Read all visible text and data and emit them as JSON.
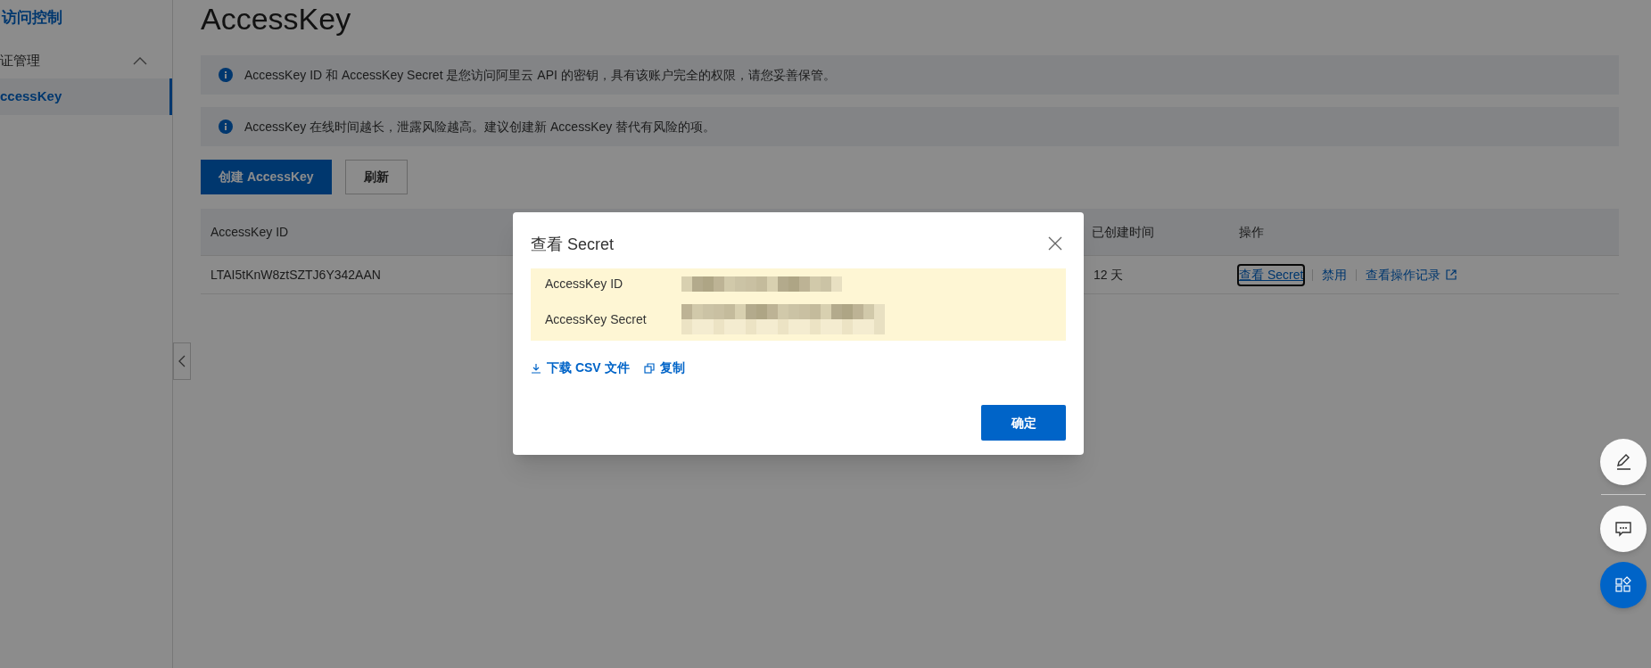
{
  "sidebar": {
    "title": "访问控制",
    "groups": [
      {
        "label": "证管理",
        "expanded": true,
        "items": [
          {
            "label": "ccessKey",
            "selected": true
          }
        ]
      }
    ]
  },
  "page_title": "AccessKey",
  "notices": [
    "AccessKey ID 和 AccessKey Secret 是您访问阿里云 API 的密钥，具有该账户完全的权限，请您妥善保管。",
    "AccessKey 在线时间越长，泄露风险越高。建议创建新 AccessKey 替代有风险的项。"
  ],
  "toolbar": [
    {
      "label": "创建 AccessKey",
      "kind": "primary"
    },
    {
      "label": "刷新",
      "kind": "secondary"
    }
  ],
  "table": {
    "columns": [
      "AccessKey ID",
      "已创建时间",
      "操作"
    ],
    "rows": [
      {
        "id": "LTAI5tKnW8ztSZTJ6Y342AAN",
        "age": "12 天",
        "actions": [
          {
            "label": "查看 Secret",
            "focused": true,
            "external": false
          },
          {
            "label": "禁用",
            "focused": false,
            "external": false
          },
          {
            "label": "查看操作记录",
            "focused": false,
            "external": true
          }
        ]
      }
    ]
  },
  "dialog": {
    "title": "查看 Secret",
    "fields": [
      {
        "label": "AccessKey ID",
        "masked": true
      },
      {
        "label": "AccessKey Secret",
        "masked": true
      }
    ],
    "links": [
      {
        "label": "下载 CSV 文件",
        "kind": "download"
      },
      {
        "label": "复制",
        "kind": "copy"
      }
    ],
    "confirm": "确定"
  },
  "float_buttons": [
    {
      "kind": "edit"
    },
    {
      "kind": "chat"
    },
    {
      "kind": "apps"
    }
  ]
}
